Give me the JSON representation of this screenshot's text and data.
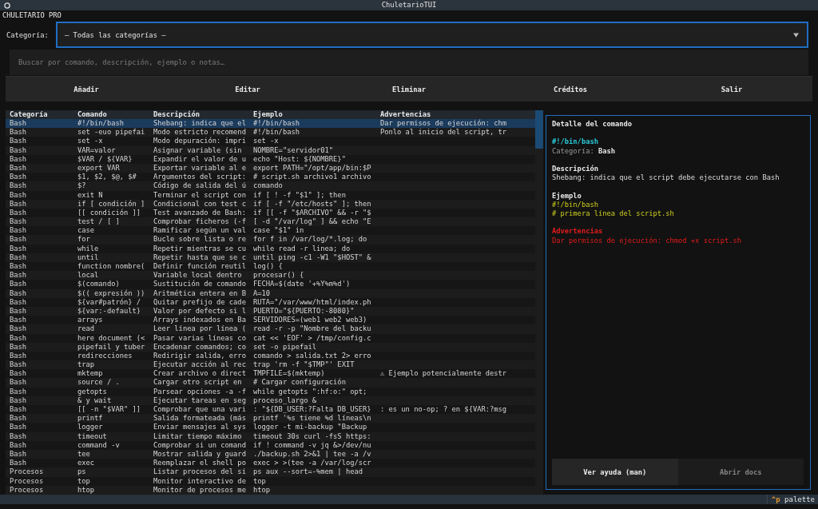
{
  "window": {
    "title": "ChuletarioTUI"
  },
  "app_name": "CHULETARIO PRO",
  "category_filter": {
    "label": "Categoría:",
    "value": "— Todas las categorías —"
  },
  "search": {
    "placeholder": "Buscar por comando, descripción, ejemplo o notas…"
  },
  "toolbar": [
    "Añadir",
    "Editar",
    "Eliminar",
    "Créditos",
    "Salir"
  ],
  "table": {
    "columns": [
      "Categoría",
      "Comando",
      "Descripción",
      "Ejemplo",
      "Advertencias"
    ],
    "rows": [
      {
        "category": "Bash",
        "command": "#!/bin/bash",
        "description": "Shebang: indica que el",
        "example": "#!/bin/bash",
        "warning": "Dar permisos de ejecución: chm",
        "selected": true
      },
      {
        "category": "Bash",
        "command": "set -euo pipefai",
        "description": "Modo estricto recomend",
        "example": "#!/bin/bash",
        "warning": "Ponlo al inicio del script, tr",
        "selected": false
      },
      {
        "category": "Bash",
        "command": "set -x",
        "description": "Modo depuración: impri",
        "example": "set -x",
        "selected": false
      },
      {
        "category": "Bash",
        "command": "VAR=valor",
        "description": "Asignar variable (sin",
        "example": "NOMBRE=\"servidor01\"",
        "selected": false
      },
      {
        "category": "Bash",
        "command": "$VAR / ${VAR}",
        "description": "Expandir el valor de u",
        "example": "echo \"Host: ${NOMBRE}\"",
        "selected": false
      },
      {
        "category": "Bash",
        "command": "export VAR",
        "description": "Exportar variable al e",
        "example": "export PATH=\"/opt/app/bin:$P",
        "selected": false
      },
      {
        "category": "Bash",
        "command": "$1, $2, $@, $#",
        "description": "Argumentos del script:",
        "example": "# script.sh archivo1 archivo",
        "selected": false
      },
      {
        "category": "Bash",
        "command": "$?",
        "description": "Código de salida del ú",
        "example": "comando",
        "selected": false
      },
      {
        "category": "Bash",
        "command": "exit N",
        "description": "Terminar el script con",
        "example": "if [ ! -f \"$1\" ]; then",
        "selected": false
      },
      {
        "category": "Bash",
        "command": "if [ condición ]",
        "description": "Condicional con test c",
        "example": "if [ -f \"/etc/hosts\" ]; then",
        "selected": false
      },
      {
        "category": "Bash",
        "command": "[[ condición ]]",
        "description": "Test avanzado de Bash:",
        "example": "if [[ -f \"$ARCHIVO\" && -r \"$",
        "selected": false
      },
      {
        "category": "Bash",
        "command": "test / [ ]",
        "description": "Comprobar ficheros (-f",
        "example": "[ -d \"/var/log\" ] && echo \"E",
        "selected": false
      },
      {
        "category": "Bash",
        "command": "case",
        "description": "Ramificar según un val",
        "example": "case \"$1\" in",
        "selected": false
      },
      {
        "category": "Bash",
        "command": "for",
        "description": "Bucle sobre lista o re",
        "example": "for f in /var/log/*.log; do",
        "selected": false
      },
      {
        "category": "Bash",
        "command": "while",
        "description": "Repetir mientras se cu",
        "example": "while read -r linea; do",
        "selected": false
      },
      {
        "category": "Bash",
        "command": "until",
        "description": "Repetir hasta que se c",
        "example": "until ping -c1 -W1 \"$HOST\" &",
        "selected": false
      },
      {
        "category": "Bash",
        "command": "function nombre(",
        "description": "Definir función reutil",
        "example": "log() {",
        "selected": false
      },
      {
        "category": "Bash",
        "command": "local",
        "description": "Variable local dentro",
        "example": "procesar() {",
        "selected": false
      },
      {
        "category": "Bash",
        "command": "$(comando)",
        "description": "Sustitución de comando",
        "example": "FECHA=$(date '+%Y%m%d')",
        "selected": false
      },
      {
        "category": "Bash",
        "command": "$(( expresión ))",
        "description": "Aritmética entera en B",
        "example": "A=10",
        "selected": false
      },
      {
        "category": "Bash",
        "command": "${var#patrón} /",
        "description": "Quitar prefijo de cade",
        "example": "RUTA=\"/var/www/html/index.ph",
        "selected": false
      },
      {
        "category": "Bash",
        "command": "${var:-default}",
        "description": "Valor por defecto si l",
        "example": "PUERTO=\"${PUERTO:-8080}\"",
        "selected": false
      },
      {
        "category": "Bash",
        "command": "arrays",
        "description": "Arrays indexados en Ba",
        "example": "SERVIDORES=(web1 web2 web3)",
        "selected": false
      },
      {
        "category": "Bash",
        "command": "read",
        "description": "Leer línea por línea (",
        "example": "read -r -p \"Nombre del backu",
        "selected": false
      },
      {
        "category": "Bash",
        "command": "here document (<",
        "description": "Pasar varias líneas co",
        "example": "cat << 'EOF' > /tmp/config.c",
        "selected": false
      },
      {
        "category": "Bash",
        "command": "pipefail y tuber",
        "description": "Encadenar comandos; co",
        "example": "set -o pipefail",
        "selected": false
      },
      {
        "category": "Bash",
        "command": "redirecciones",
        "description": "Redirigir salida, erro",
        "example": "comando > salida.txt 2> erro",
        "selected": false
      },
      {
        "category": "Bash",
        "command": "trap",
        "description": "Ejecutar acción al rec",
        "example": "trap 'rm -f \"$TMP\"' EXIT",
        "selected": false
      },
      {
        "category": "Bash",
        "command": "mktemp",
        "description": "Crear archivo o direct",
        "example": "TMPFILE=$(mktemp)",
        "warning": "⚠ Ejemplo potencialmente destr",
        "selected": false
      },
      {
        "category": "Bash",
        "command": "source / .",
        "description": "Cargar otro script en",
        "example": "# Cargar configuración",
        "selected": false
      },
      {
        "category": "Bash",
        "command": "getopts",
        "description": "Parsear opciones -a -f",
        "example": "while getopts \":hf:o:\" opt;",
        "selected": false
      },
      {
        "category": "Bash",
        "command": "& y wait",
        "description": "Ejecutar tareas en seg",
        "example": "proceso_largo &",
        "selected": false
      },
      {
        "category": "Bash",
        "command": "[[ -n \"$VAR\" ]]",
        "description": "Comprobar que una vari",
        "example": ": \"${DB_USER:?Falta DB_USER}",
        "warning": ": es un no-op; ? en ${VAR:?msg",
        "selected": false
      },
      {
        "category": "Bash",
        "command": "printf",
        "description": "Salida formateada (más",
        "example": "printf '%s tiene %d líneas\\n",
        "selected": false
      },
      {
        "category": "Bash",
        "command": "logger",
        "description": "Enviar mensajes al sys",
        "example": "logger -t mi-backup \"Backup",
        "selected": false
      },
      {
        "category": "Bash",
        "command": "timeout",
        "description": "Limitar tiempo máximo",
        "example": "timeout 30s curl -fsS https:",
        "selected": false
      },
      {
        "category": "Bash",
        "command": "command -v",
        "description": "Comprobar si un comand",
        "example": "if ! command -v jq &>/dev/nu",
        "selected": false
      },
      {
        "category": "Bash",
        "command": "tee",
        "description": "Mostrar salida y guard",
        "example": "./backup.sh 2>&1 | tee -a /v",
        "selected": false
      },
      {
        "category": "Bash",
        "command": "exec",
        "description": "Reemplazar el shell po",
        "example": "exec > >(tee -a /var/log/scr",
        "selected": false
      },
      {
        "category": "Procesos",
        "command": "ps",
        "description": "Listar procesos del si",
        "example": "ps aux --sort=-%mem | head",
        "selected": false
      },
      {
        "category": "Procesos",
        "command": "top",
        "description": "Monitor interactivo de",
        "example": "top",
        "selected": false
      },
      {
        "category": "Procesos",
        "command": "htop",
        "description": "Monitor de procesos me",
        "example": "htop",
        "selected": false
      }
    ]
  },
  "detail": {
    "title": "Detalle del comando",
    "command": "#!/bin/bash",
    "category_label": "Categoría:",
    "category": "Bash",
    "sections": [
      {
        "kind": "description",
        "heading": "Descripción",
        "lines": [
          "Shebang: indica que el script debe ejecutarse con Bash"
        ]
      },
      {
        "kind": "example",
        "heading": "Ejemplo",
        "lines": [
          "#!/bin/bash",
          "# primera línea del script.sh"
        ]
      },
      {
        "kind": "warning",
        "heading": "Advertencias",
        "lines": [
          "Dar permisos de ejecución: chmod +x script.sh"
        ]
      }
    ],
    "buttons": [
      {
        "label": "Ver ayuda (man)",
        "disabled": false
      },
      {
        "label": "Abrir docs",
        "disabled": true
      }
    ]
  },
  "footer": {
    "key": "^p",
    "label": "palette"
  }
}
